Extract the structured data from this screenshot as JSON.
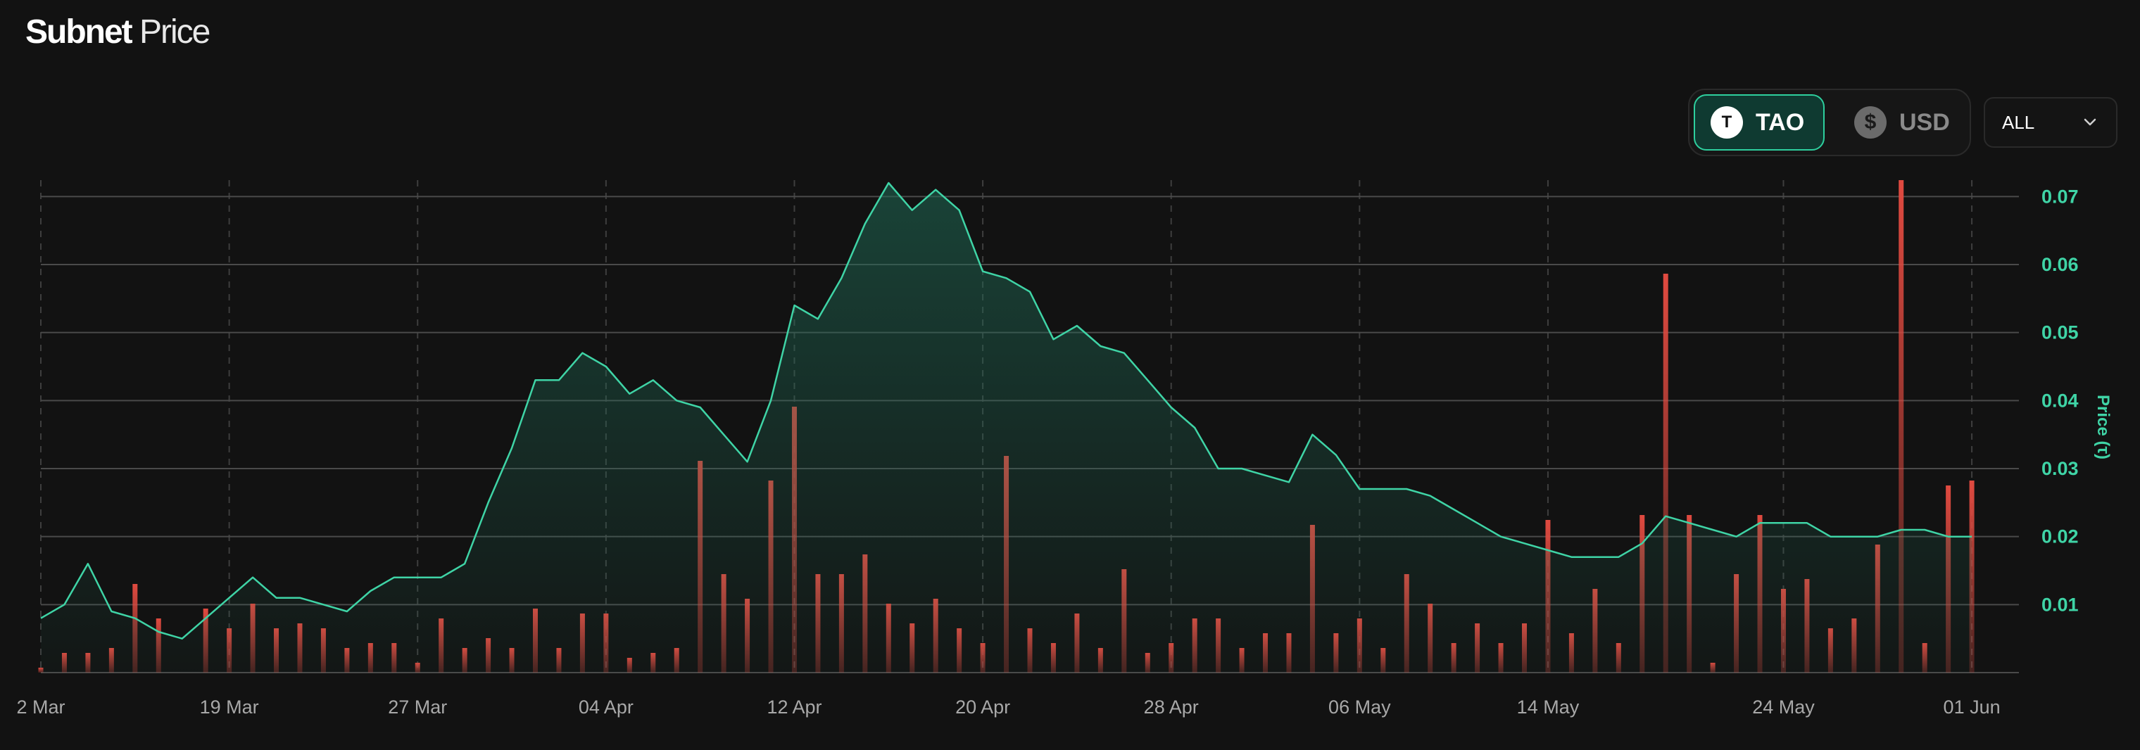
{
  "header": {
    "title_bold": "Subnet",
    "title_light": "Price"
  },
  "currency_toggle": {
    "options": [
      {
        "label": "TAO",
        "icon": "T",
        "active": true
      },
      {
        "label": "USD",
        "icon": "$",
        "active": false
      }
    ]
  },
  "range_select": {
    "value": "ALL"
  },
  "colors": {
    "line": "#3fd4a6",
    "bar": "#d9463e",
    "accent_text": "#3fd4a6",
    "grid": "#4a4a4a"
  },
  "chart_data": {
    "type": "line",
    "ylabel": "Price (τ)",
    "ylim": [
      0,
      0.072
    ],
    "yticks": [
      0.01,
      0.02,
      0.03,
      0.04,
      0.05,
      0.06,
      0.07
    ],
    "x_start": "2024-03-11",
    "x_end": "2024-06-03",
    "xticks": [
      {
        "date": "2024-03-11",
        "label": "2 Mar"
      },
      {
        "date": "2024-03-19",
        "label": "19 Mar"
      },
      {
        "date": "2024-03-27",
        "label": "27 Mar"
      },
      {
        "date": "2024-04-04",
        "label": "04 Apr"
      },
      {
        "date": "2024-04-12",
        "label": "12 Apr"
      },
      {
        "date": "2024-04-20",
        "label": "20 Apr"
      },
      {
        "date": "2024-04-28",
        "label": "28 Apr"
      },
      {
        "date": "2024-05-06",
        "label": "06 May"
      },
      {
        "date": "2024-05-14",
        "label": "14 May"
      },
      {
        "date": "2024-05-24",
        "label": "24 May"
      },
      {
        "date": "2024-06-01",
        "label": "01 Jun"
      }
    ],
    "series": [
      {
        "type": "line",
        "values": [
          [
            "2024-03-11",
            0.008
          ],
          [
            "2024-03-12",
            0.01
          ],
          [
            "2024-03-13",
            0.016
          ],
          [
            "2024-03-14",
            0.009
          ],
          [
            "2024-03-15",
            0.008
          ],
          [
            "2024-03-16",
            0.006
          ],
          [
            "2024-03-17",
            0.005
          ],
          [
            "2024-03-18",
            0.008
          ],
          [
            "2024-03-19",
            0.011
          ],
          [
            "2024-03-20",
            0.014
          ],
          [
            "2024-03-21",
            0.011
          ],
          [
            "2024-03-22",
            0.011
          ],
          [
            "2024-03-23",
            0.01
          ],
          [
            "2024-03-24",
            0.009
          ],
          [
            "2024-03-25",
            0.012
          ],
          [
            "2024-03-26",
            0.014
          ],
          [
            "2024-03-27",
            0.014
          ],
          [
            "2024-03-28",
            0.014
          ],
          [
            "2024-03-29",
            0.016
          ],
          [
            "2024-03-30",
            0.025
          ],
          [
            "2024-03-31",
            0.033
          ],
          [
            "2024-04-01",
            0.043
          ],
          [
            "2024-04-02",
            0.043
          ],
          [
            "2024-04-03",
            0.047
          ],
          [
            "2024-04-04",
            0.045
          ],
          [
            "2024-04-05",
            0.041
          ],
          [
            "2024-04-06",
            0.043
          ],
          [
            "2024-04-07",
            0.04
          ],
          [
            "2024-04-08",
            0.039
          ],
          [
            "2024-04-09",
            0.035
          ],
          [
            "2024-04-10",
            0.031
          ],
          [
            "2024-04-11",
            0.04
          ],
          [
            "2024-04-12",
            0.054
          ],
          [
            "2024-04-13",
            0.052
          ],
          [
            "2024-04-14",
            0.058
          ],
          [
            "2024-04-15",
            0.066
          ],
          [
            "2024-04-16",
            0.072
          ],
          [
            "2024-04-17",
            0.068
          ],
          [
            "2024-04-18",
            0.071
          ],
          [
            "2024-04-19",
            0.068
          ],
          [
            "2024-04-20",
            0.059
          ],
          [
            "2024-04-21",
            0.058
          ],
          [
            "2024-04-22",
            0.056
          ],
          [
            "2024-04-23",
            0.049
          ],
          [
            "2024-04-24",
            0.051
          ],
          [
            "2024-04-25",
            0.048
          ],
          [
            "2024-04-26",
            0.047
          ],
          [
            "2024-04-27",
            0.043
          ],
          [
            "2024-04-28",
            0.039
          ],
          [
            "2024-04-29",
            0.036
          ],
          [
            "2024-04-30",
            0.03
          ],
          [
            "2024-05-01",
            0.03
          ],
          [
            "2024-05-02",
            0.029
          ],
          [
            "2024-05-03",
            0.028
          ],
          [
            "2024-05-04",
            0.035
          ],
          [
            "2024-05-05",
            0.032
          ],
          [
            "2024-05-06",
            0.027
          ],
          [
            "2024-05-07",
            0.027
          ],
          [
            "2024-05-08",
            0.027
          ],
          [
            "2024-05-09",
            0.026
          ],
          [
            "2024-05-10",
            0.024
          ],
          [
            "2024-05-11",
            0.022
          ],
          [
            "2024-05-12",
            0.02
          ],
          [
            "2024-05-13",
            0.019
          ],
          [
            "2024-05-14",
            0.018
          ],
          [
            "2024-05-15",
            0.017
          ],
          [
            "2024-05-16",
            0.017
          ],
          [
            "2024-05-17",
            0.017
          ],
          [
            "2024-05-18",
            0.019
          ],
          [
            "2024-05-19",
            0.023
          ],
          [
            "2024-05-20",
            0.022
          ],
          [
            "2024-05-21",
            0.021
          ],
          [
            "2024-05-22",
            0.02
          ],
          [
            "2024-05-23",
            0.022
          ],
          [
            "2024-05-24",
            0.022
          ],
          [
            "2024-05-25",
            0.022
          ],
          [
            "2024-05-26",
            0.02
          ],
          [
            "2024-05-27",
            0.02
          ],
          [
            "2024-05-28",
            0.02
          ],
          [
            "2024-05-29",
            0.021
          ],
          [
            "2024-05-30",
            0.021
          ],
          [
            "2024-05-31",
            0.02
          ],
          [
            "2024-06-01",
            0.02
          ]
        ]
      },
      {
        "type": "bar",
        "y_axis": "unlabeled",
        "ylim": [
          0,
          1
        ],
        "values": [
          [
            "2024-03-11",
            0.01
          ],
          [
            "2024-03-12",
            0.04
          ],
          [
            "2024-03-13",
            0.04
          ],
          [
            "2024-03-14",
            0.05
          ],
          [
            "2024-03-15",
            0.18
          ],
          [
            "2024-03-16",
            0.11
          ],
          [
            "2024-03-17",
            0.0
          ],
          [
            "2024-03-18",
            0.13
          ],
          [
            "2024-03-19",
            0.09
          ],
          [
            "2024-03-20",
            0.14
          ],
          [
            "2024-03-21",
            0.09
          ],
          [
            "2024-03-22",
            0.1
          ],
          [
            "2024-03-23",
            0.09
          ],
          [
            "2024-03-24",
            0.05
          ],
          [
            "2024-03-25",
            0.06
          ],
          [
            "2024-03-26",
            0.06
          ],
          [
            "2024-03-27",
            0.02
          ],
          [
            "2024-03-28",
            0.11
          ],
          [
            "2024-03-29",
            0.05
          ],
          [
            "2024-03-30",
            0.07
          ],
          [
            "2024-03-31",
            0.05
          ],
          [
            "2024-04-01",
            0.13
          ],
          [
            "2024-04-02",
            0.05
          ],
          [
            "2024-04-03",
            0.12
          ],
          [
            "2024-04-04",
            0.12
          ],
          [
            "2024-04-05",
            0.03
          ],
          [
            "2024-04-06",
            0.04
          ],
          [
            "2024-04-07",
            0.05
          ],
          [
            "2024-04-08",
            0.43
          ],
          [
            "2024-04-09",
            0.2
          ],
          [
            "2024-04-10",
            0.15
          ],
          [
            "2024-04-11",
            0.39
          ],
          [
            "2024-04-12",
            0.54
          ],
          [
            "2024-04-13",
            0.2
          ],
          [
            "2024-04-14",
            0.2
          ],
          [
            "2024-04-15",
            0.24
          ],
          [
            "2024-04-16",
            0.14
          ],
          [
            "2024-04-17",
            0.1
          ],
          [
            "2024-04-18",
            0.15
          ],
          [
            "2024-04-19",
            0.09
          ],
          [
            "2024-04-20",
            0.06
          ],
          [
            "2024-04-21",
            0.44
          ],
          [
            "2024-04-22",
            0.09
          ],
          [
            "2024-04-23",
            0.06
          ],
          [
            "2024-04-24",
            0.12
          ],
          [
            "2024-04-25",
            0.05
          ],
          [
            "2024-04-26",
            0.21
          ],
          [
            "2024-04-27",
            0.04
          ],
          [
            "2024-04-28",
            0.06
          ],
          [
            "2024-04-29",
            0.11
          ],
          [
            "2024-04-30",
            0.11
          ],
          [
            "2024-05-01",
            0.05
          ],
          [
            "2024-05-02",
            0.08
          ],
          [
            "2024-05-03",
            0.08
          ],
          [
            "2024-05-04",
            0.3
          ],
          [
            "2024-05-05",
            0.08
          ],
          [
            "2024-05-06",
            0.11
          ],
          [
            "2024-05-07",
            0.05
          ],
          [
            "2024-05-08",
            0.2
          ],
          [
            "2024-05-09",
            0.14
          ],
          [
            "2024-05-10",
            0.06
          ],
          [
            "2024-05-11",
            0.1
          ],
          [
            "2024-05-12",
            0.06
          ],
          [
            "2024-05-13",
            0.1
          ],
          [
            "2024-05-14",
            0.31
          ],
          [
            "2024-05-15",
            0.08
          ],
          [
            "2024-05-16",
            0.17
          ],
          [
            "2024-05-17",
            0.06
          ],
          [
            "2024-05-18",
            0.32
          ],
          [
            "2024-05-19",
            0.81
          ],
          [
            "2024-05-20",
            0.32
          ],
          [
            "2024-05-21",
            0.02
          ],
          [
            "2024-05-22",
            0.2
          ],
          [
            "2024-05-23",
            0.32
          ],
          [
            "2024-05-24",
            0.17
          ],
          [
            "2024-05-25",
            0.19
          ],
          [
            "2024-05-26",
            0.09
          ],
          [
            "2024-05-27",
            0.11
          ],
          [
            "2024-05-28",
            0.26
          ],
          [
            "2024-05-29",
            1.0
          ],
          [
            "2024-05-30",
            0.06
          ],
          [
            "2024-05-31",
            0.38
          ],
          [
            "2024-06-01",
            0.39
          ]
        ]
      }
    ],
    "grid": true
  }
}
